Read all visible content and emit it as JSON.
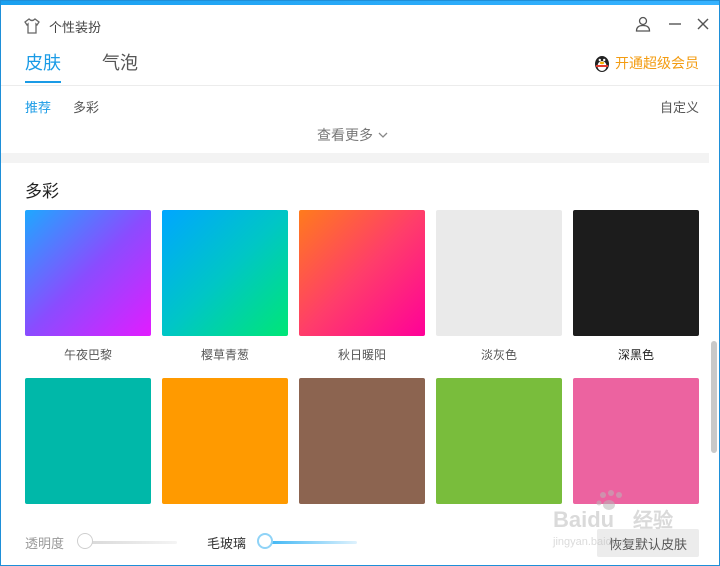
{
  "window": {
    "title": "个性装扮",
    "title_icon": "tshirt-icon"
  },
  "titlebar": {
    "user_icon": "user-icon",
    "minimize_icon": "minimize-icon",
    "close_icon": "close-icon"
  },
  "tabs": [
    {
      "label": "皮肤",
      "active": true
    },
    {
      "label": "气泡",
      "active": false
    }
  ],
  "vip": {
    "label": "开通超级会员",
    "icon": "qq-penguin-icon",
    "color": "#f39c12"
  },
  "subtabs": [
    {
      "label": "推荐",
      "active": true
    },
    {
      "label": "多彩",
      "active": false
    }
  ],
  "custom_label": "自定义",
  "more_label": "查看更多",
  "section_title": "多彩",
  "swatches_row1": [
    {
      "label": "午夜巴黎",
      "gradient": [
        "#1ea8ff",
        "#8a4cff",
        "#e21cff"
      ]
    },
    {
      "label": "樱草青葱",
      "gradient": [
        "#00a6ff",
        "#00c6c6",
        "#00e676"
      ]
    },
    {
      "label": "秋日暖阳",
      "gradient": [
        "#ff7b1c",
        "#ff3d6a",
        "#ff0099"
      ]
    },
    {
      "label": "淡灰色",
      "color": "#eaeaea"
    },
    {
      "label": "深黑色",
      "color": "#1c1c1c"
    }
  ],
  "swatches_row2": [
    {
      "color": "#00b8a9"
    },
    {
      "color": "#ff9a00"
    },
    {
      "color": "#8c6450"
    },
    {
      "color": "#79bd3c"
    },
    {
      "color": "#ec63a0"
    }
  ],
  "bottom": {
    "opacity_label": "透明度",
    "opacity_value": 0,
    "frosted_label": "毛玻璃",
    "frosted_value": 0,
    "reset_label": "恢复默认皮肤"
  },
  "watermark": {
    "brand": "Baidu",
    "cn": "经验",
    "url": "jingyan.baidu.com"
  },
  "accent": "#1a9be6"
}
